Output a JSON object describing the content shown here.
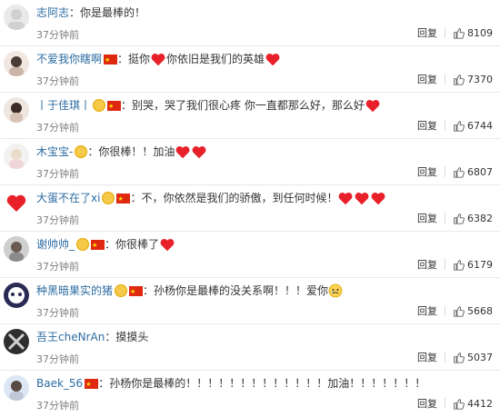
{
  "comments": [
    {
      "name": "志阿志",
      "sep": "：",
      "text": "你是最棒的！",
      "time": "37分钟前",
      "reply": "回复",
      "likes": "8109",
      "hearts": 0,
      "flag": false,
      "badge": false
    },
    {
      "name": "不爱我你瞎啊",
      "sep": "：",
      "text": "挺你",
      "text2": "你依旧是我们的英雄",
      "time": "37分钟前",
      "reply": "回复",
      "likes": "7370",
      "flag": true,
      "badge": false
    },
    {
      "name": "丨于佳琪丨",
      "sep": "：",
      "text": "别哭，哭了我们很心疼 你一直都那么好，那么好",
      "time": "37分钟前",
      "reply": "回复",
      "likes": "6744",
      "flag": true,
      "badge": true
    },
    {
      "name": "木宝宝-",
      "sep": "：",
      "text": "你很棒！！加油",
      "time": "37分钟前",
      "reply": "回复",
      "likes": "6807",
      "flag": false,
      "badge": true
    },
    {
      "name": "大蛋不在了xi",
      "sep": "：",
      "text": "不，你依然是我们的骄傲，到任何时候！",
      "time": "37分钟前",
      "reply": "回复",
      "likes": "6382",
      "flag": true,
      "badge": true
    },
    {
      "name": "谢帅帅_",
      "sep": "：",
      "text": "你很棒了",
      "time": "37分钟前",
      "reply": "回复",
      "likes": "6179",
      "flag": true,
      "badge": true
    },
    {
      "name": "种黑暗果实的猪",
      "sep": "：",
      "text": "孙杨你是最棒的没关系啊！！！爱你",
      "time": "37分钟前",
      "reply": "回复",
      "likes": "5668",
      "flag": true,
      "badge": true
    },
    {
      "name": "吾王cheNrAn",
      "sep": "：",
      "text": "摸摸头",
      "time": "37分钟前",
      "reply": "回复",
      "likes": "5037",
      "flag": false,
      "badge": false
    },
    {
      "name": "Baek_56",
      "sep": "：",
      "text": "孙杨你是最棒的！！！！！！！！！！！！！加油！！！！！！！",
      "time": "37分钟前",
      "reply": "回复",
      "likes": "4412",
      "flag": true,
      "badge": false
    }
  ],
  "colors": {
    "name": "#2d6ca2",
    "heart": "#e8202a",
    "flag": "#de2910"
  }
}
